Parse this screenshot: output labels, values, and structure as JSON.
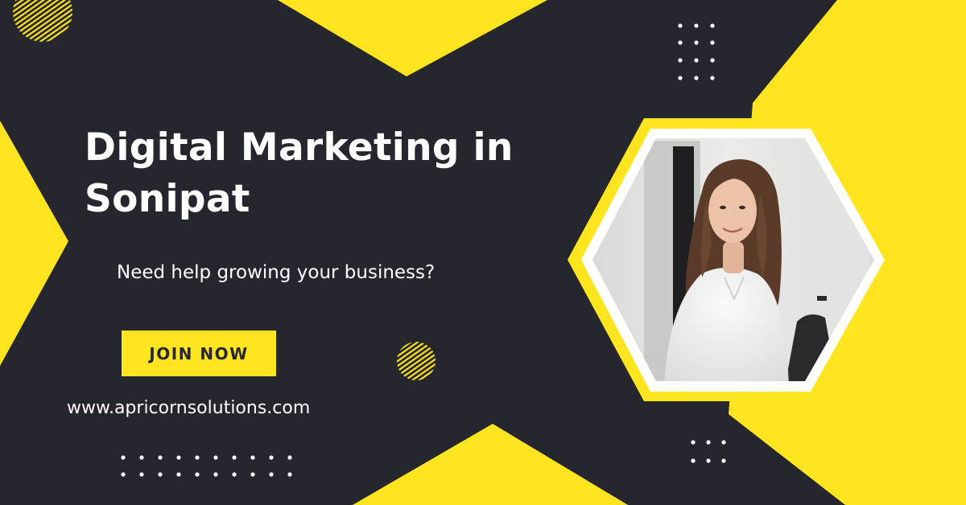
{
  "banner": {
    "headline": "Digital Marketing in Sonipat",
    "subline": "Need help growing your business?",
    "cta_label": "JOIN NOW",
    "website": "www.apricornsolutions.com"
  },
  "colors": {
    "background": "#26262e",
    "accent_yellow": "#ffe51f",
    "text": "#ffffff"
  },
  "icons": {
    "dot_grids": "dot-grid-icon",
    "hatched_circles": "hatched-circle-icon"
  }
}
